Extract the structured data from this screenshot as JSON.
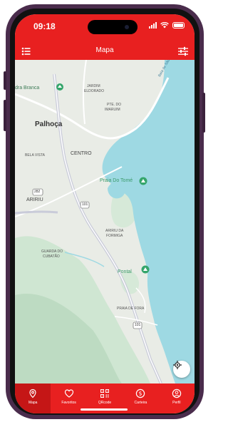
{
  "status_bar": {
    "time": "09:18"
  },
  "header": {
    "title": "Mapa",
    "menu_icon": "list-icon",
    "filter_icon": "sliders-icon"
  },
  "map": {
    "labels": {
      "pedra_branca": "dra Branca",
      "jardim": "JARDIM",
      "eldorado": "ELDORADO",
      "pte_do": "PTE. DO",
      "imaruim": "IMARUIM",
      "palhoca": "Palhoça",
      "bela_vista": "BELA VISTA",
      "centro": "CENTRO",
      "praia_do_tome": "Praia Do Tomé",
      "route_282": "282",
      "ariri": "ARIRIU",
      "route_101_a": "101",
      "ariri_da": "ARIRIU DA",
      "formiga": "FORMIGA",
      "guarda_do": "GUARDA DO",
      "cubatao": "CUBATÃO",
      "pontal": "Pontal",
      "praia_de_fora": "PRAIA DE FORA",
      "route_101_b": "101",
      "baia": "Baía de São José"
    },
    "colors": {
      "water": "#9ed9e3",
      "land": "#e9ece6",
      "green": "#cfe6d2",
      "pin": "#35a56b"
    }
  },
  "tabs": [
    {
      "label": "Mapa",
      "icon": "map-pin-icon",
      "active": true
    },
    {
      "label": "Favoritos",
      "icon": "heart-icon",
      "active": false
    },
    {
      "label": "QRcode",
      "icon": "qrcode-icon",
      "active": false
    },
    {
      "label": "Carteira",
      "icon": "dollar-coin-icon",
      "active": false
    },
    {
      "label": "Perfil",
      "icon": "user-icon",
      "active": false
    }
  ],
  "colors": {
    "brand": "#e82020",
    "active_tab": "#c51616"
  }
}
